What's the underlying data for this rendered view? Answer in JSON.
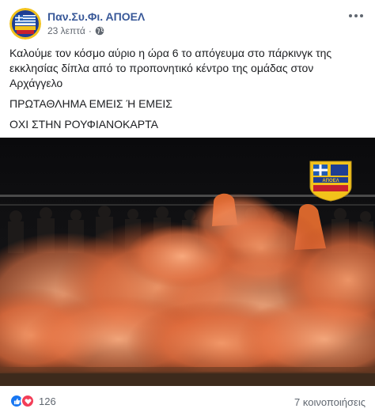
{
  "post": {
    "author": "Παν.Συ.Φι. ΑΠΟΕΛ",
    "time": "23 λεπτά",
    "separator": "·",
    "privacy_icon": "globe-icon",
    "paragraphs": [
      "Καλούμε τον κόσμο αύριο η ώρα 6 το απόγευμα στο πάρκινγκ της εκκλησίας δίπλα από το προπονητικό κέντρο της ομάδας στον Αρχάγγελο",
      "ΠΡΩΤΑΘΛΗΜΑ ΕΜΕΙΣ Ή ΕΜΕΙΣ",
      "ΟΧΙ ΣΤΗΝ ΡΟΥΦΙΑΝΟΚΑΡΤΑ"
    ],
    "photo_logo_text": "ΑΠΟΕΛ"
  },
  "footer": {
    "reaction_icons": [
      "like-icon",
      "love-icon"
    ],
    "reaction_count": "126",
    "shares": "7 κοινοποιήσεις"
  },
  "colors": {
    "author_link": "#385898",
    "smoke": "#e8774a",
    "like": "#1877f2",
    "love": "#f33e58",
    "crest_yellow": "#f2c21b",
    "crest_blue": "#1f3e93"
  }
}
